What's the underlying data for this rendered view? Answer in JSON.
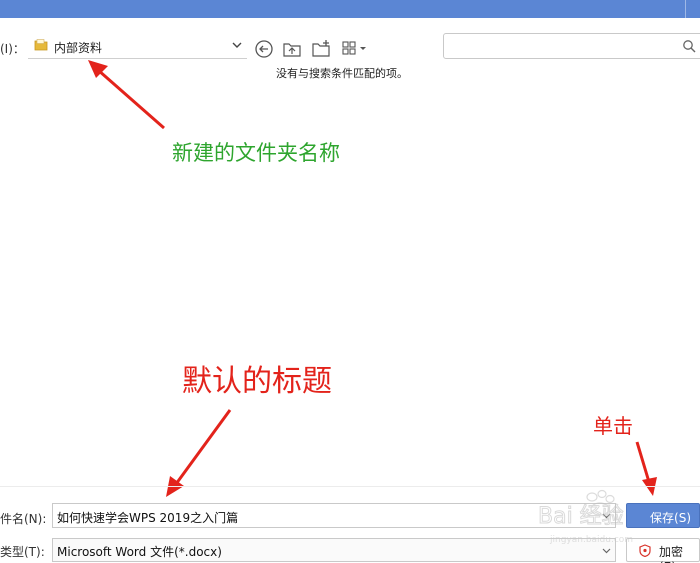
{
  "location": {
    "label": "(I)：",
    "folder_name": "内部资料"
  },
  "toolbar": {
    "back_icon": "back-circle-icon",
    "up_folder_icon": "up-folder-icon",
    "new_folder_icon": "new-folder-icon",
    "view_icon": "grid-view-icon"
  },
  "search": {
    "value": "",
    "icon": "search-icon"
  },
  "file_list": {
    "empty_message": "没有与搜索条件匹配的项。"
  },
  "annotations": {
    "folder_note": "新建的文件夹名称",
    "title_note": "默认的标题",
    "click_note": "单击",
    "color_green": "#2ea52e",
    "color_red": "#e3231b"
  },
  "filename": {
    "label": "件名(N):",
    "value": "如何快速学会WPS 2019之入门篇"
  },
  "filetype": {
    "label": "类型(T):",
    "value": "Microsoft Word 文件(*.docx)"
  },
  "buttons": {
    "save": "保存(S)",
    "encrypt": "加密(E)"
  },
  "watermark": {
    "text": "Bai 经验",
    "sub": "jingyan.baidu.com"
  },
  "colors": {
    "titlebar": "#5b86d4",
    "accent": "#5b86d4"
  }
}
